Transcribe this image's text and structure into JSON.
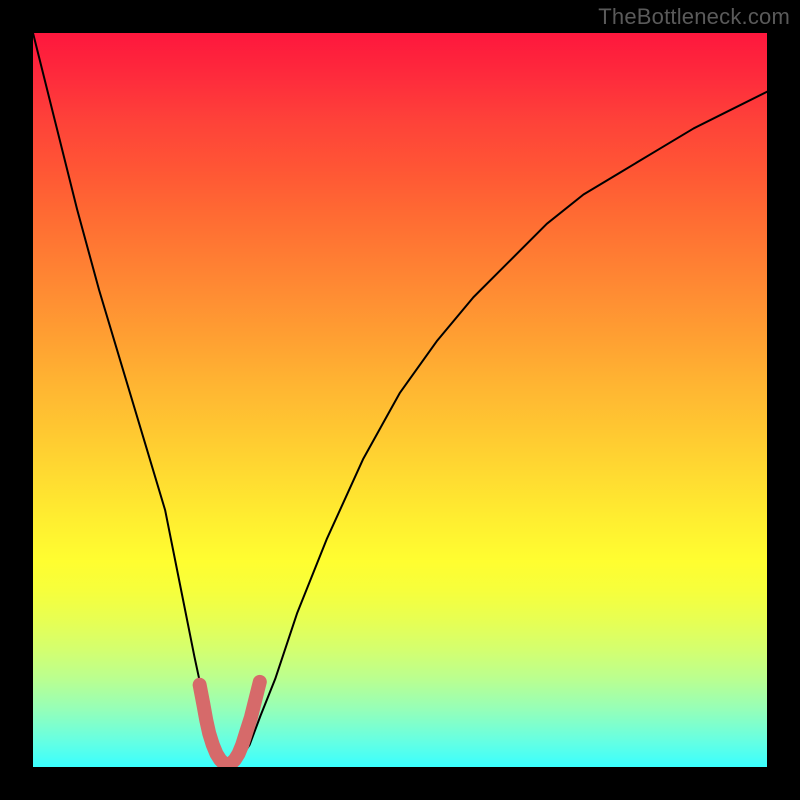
{
  "attribution": "TheBottleneck.com",
  "chart_data": {
    "type": "line",
    "title": "",
    "xlabel": "",
    "ylabel": "",
    "xlim": [
      0,
      100
    ],
    "ylim": [
      0,
      100
    ],
    "x": [
      0,
      3,
      6,
      9,
      12,
      15,
      18,
      20,
      22,
      23.5,
      25,
      26,
      27,
      28,
      29.5,
      31,
      33,
      36,
      40,
      45,
      50,
      55,
      60,
      65,
      70,
      75,
      80,
      85,
      90,
      95,
      100
    ],
    "y": [
      100,
      88,
      76,
      65,
      55,
      45,
      35,
      25,
      15,
      8,
      3,
      0.8,
      0.3,
      0.8,
      3,
      7,
      12,
      21,
      31,
      42,
      51,
      58,
      64,
      69,
      74,
      78,
      81,
      84,
      87,
      89.5,
      92
    ],
    "highlight_segment": {
      "x": [
        22.7,
        23.2,
        23.6,
        24.0,
        24.5,
        25.0,
        25.5,
        26.0,
        26.5,
        27.0,
        27.5,
        28.0,
        28.5,
        29.0,
        29.7,
        30.3,
        30.9
      ],
      "y": [
        11.2,
        8.6,
        6.4,
        4.6,
        3.0,
        1.8,
        1.0,
        0.5,
        0.3,
        0.5,
        1.0,
        1.8,
        3.0,
        4.6,
        6.8,
        9.2,
        11.6
      ]
    },
    "colors": {
      "main_line": "#000000",
      "highlight_line": "#d66a6a"
    }
  }
}
